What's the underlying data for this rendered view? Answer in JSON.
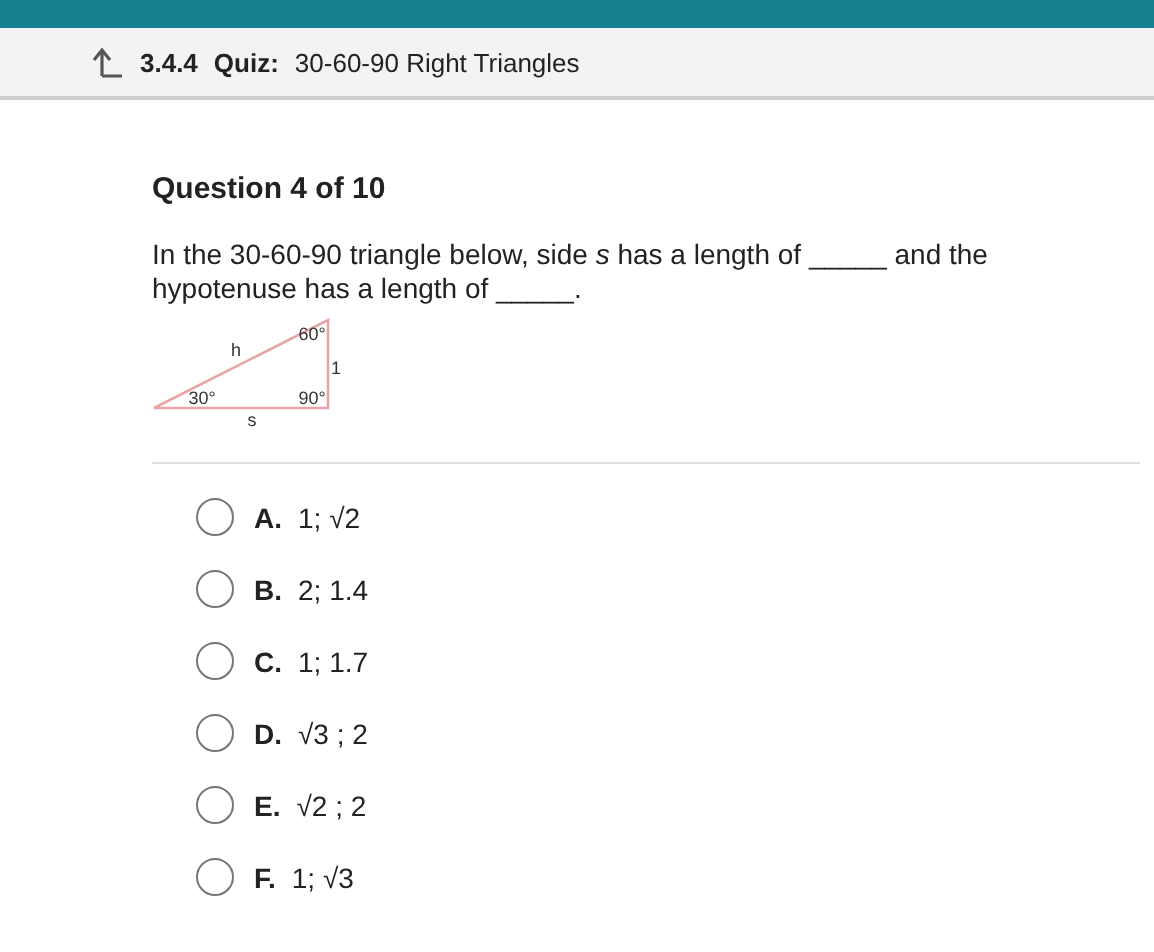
{
  "header": {
    "number": "3.4.4",
    "type": "Quiz:",
    "title": "30-60-90 Right Triangles"
  },
  "question": {
    "heading": "Question 4 of 10",
    "text": "In the 30-60-90 triangle below, side *s* has a length of _____ and the hypotenuse has a length of _____.",
    "figure": {
      "hypotenuse": "h",
      "top_angle": "60°",
      "vertical_side": "1",
      "left_angle": "30°",
      "right_angle": "90°",
      "base": "s"
    }
  },
  "options": [
    {
      "letter": "A.",
      "answer": "1; √2",
      "selected": false
    },
    {
      "letter": "B.",
      "answer": "2; 1.4",
      "selected": false
    },
    {
      "letter": "C.",
      "answer": "1; 1.7",
      "selected": false
    },
    {
      "letter": "D.",
      "answer": "√3 ; 2",
      "selected": false
    },
    {
      "letter": "E.",
      "answer": "√2 ; 2",
      "selected": false
    },
    {
      "letter": "F.",
      "answer": "1; √3",
      "selected": false
    }
  ]
}
